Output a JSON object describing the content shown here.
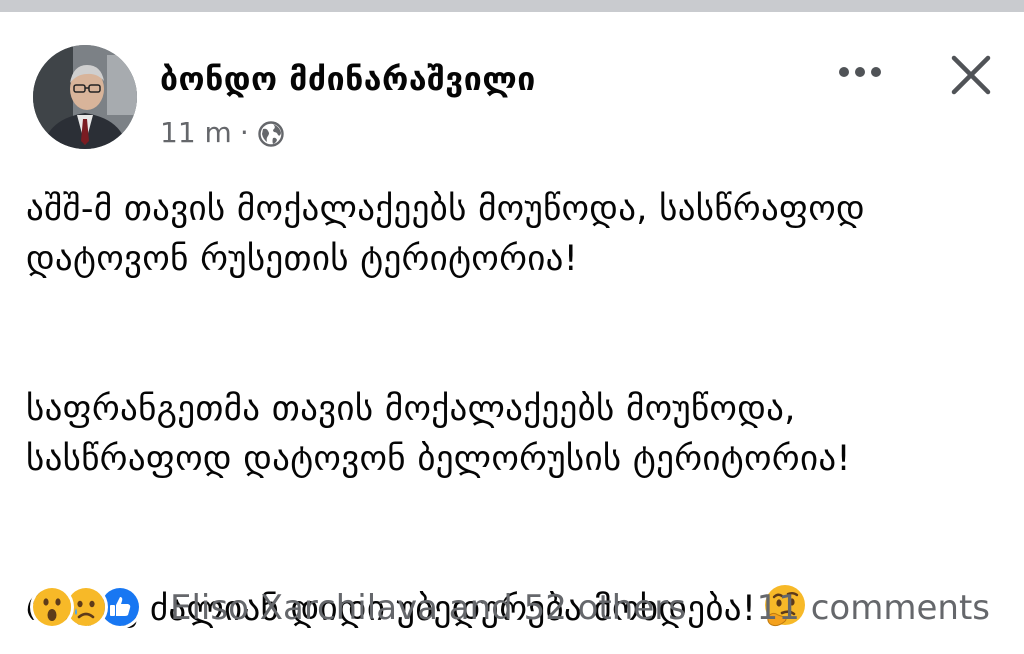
{
  "post": {
    "author": "ბონდო მძინარაშვილი",
    "time": "11 m",
    "separator": "·",
    "privacy_icon": "globe-icon",
    "paragraphs": [
      [
        "აშშ-მ თავის მოქალაქეებს მოუწოდა, სასწრაფოდ",
        "დატოვონ რუსეთის ტერიტორია!"
      ],
      [
        "საფრანგეთმა თავის მოქალაქეებს მოუწოდა,",
        "სასწრაფოდ დატოვონ ბელორუსის ტერიტორია!"
      ],
      [
        "რაღაც ძალიან დიდი უბედურება მოხდება!"
      ]
    ],
    "trailing_emoji": "thinking-face"
  },
  "header_actions": {
    "more_icon": "more-horizontal-icon",
    "close_icon": "close-icon"
  },
  "footer": {
    "reactions": [
      "wow",
      "sad",
      "like"
    ],
    "reactors_text": "Eliso Xarchilava and 52 others",
    "comments_text": "11 comments"
  },
  "colors": {
    "text": "#050505",
    "secondary": "#65676b",
    "like_blue": "#1877f2",
    "emoji_yellow": "#f7b928"
  }
}
